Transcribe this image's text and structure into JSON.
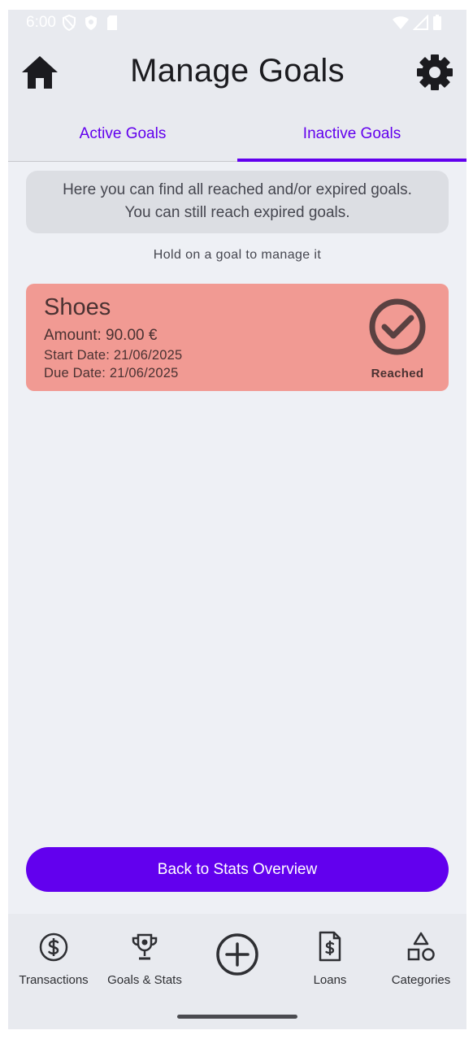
{
  "status_bar": {
    "time": "6:00",
    "left_icons": [
      "vpn-shield-icon",
      "shield-badge-icon",
      "sd-card-icon"
    ],
    "right_icons": [
      "wifi-icon",
      "signal-icon",
      "battery-icon"
    ]
  },
  "header": {
    "title": "Manage Goals",
    "home_icon": "home-icon",
    "settings_icon": "gear-icon"
  },
  "tabs": [
    {
      "label": "Active Goals",
      "selected": false
    },
    {
      "label": "Inactive Goals",
      "selected": true
    }
  ],
  "info": {
    "line1": "Here you can find all reached and/or expired goals.",
    "line2": "You can still reach expired goals."
  },
  "hint": "Hold on a goal to manage it",
  "goals": [
    {
      "name": "Shoes",
      "amount": "Amount: 90.00 €",
      "start_date": "Start Date: 21/06/2025",
      "due_date": "Due Date: 21/06/2025",
      "status": "Reached",
      "status_icon": "check-circle-icon"
    }
  ],
  "back_button": "Back to Stats Overview",
  "bottom_nav": [
    {
      "label": "Transactions",
      "icon": "dollar-circle-icon"
    },
    {
      "label": "Goals & Stats",
      "icon": "trophy-icon"
    },
    {
      "label": "",
      "icon": "add-circle-icon"
    },
    {
      "label": "Loans",
      "icon": "invoice-dollar-icon"
    },
    {
      "label": "Categories",
      "icon": "shapes-icon"
    }
  ],
  "colors": {
    "accent": "#6200ee",
    "card_reached": "#f19a93",
    "background": "#eef0f5"
  }
}
